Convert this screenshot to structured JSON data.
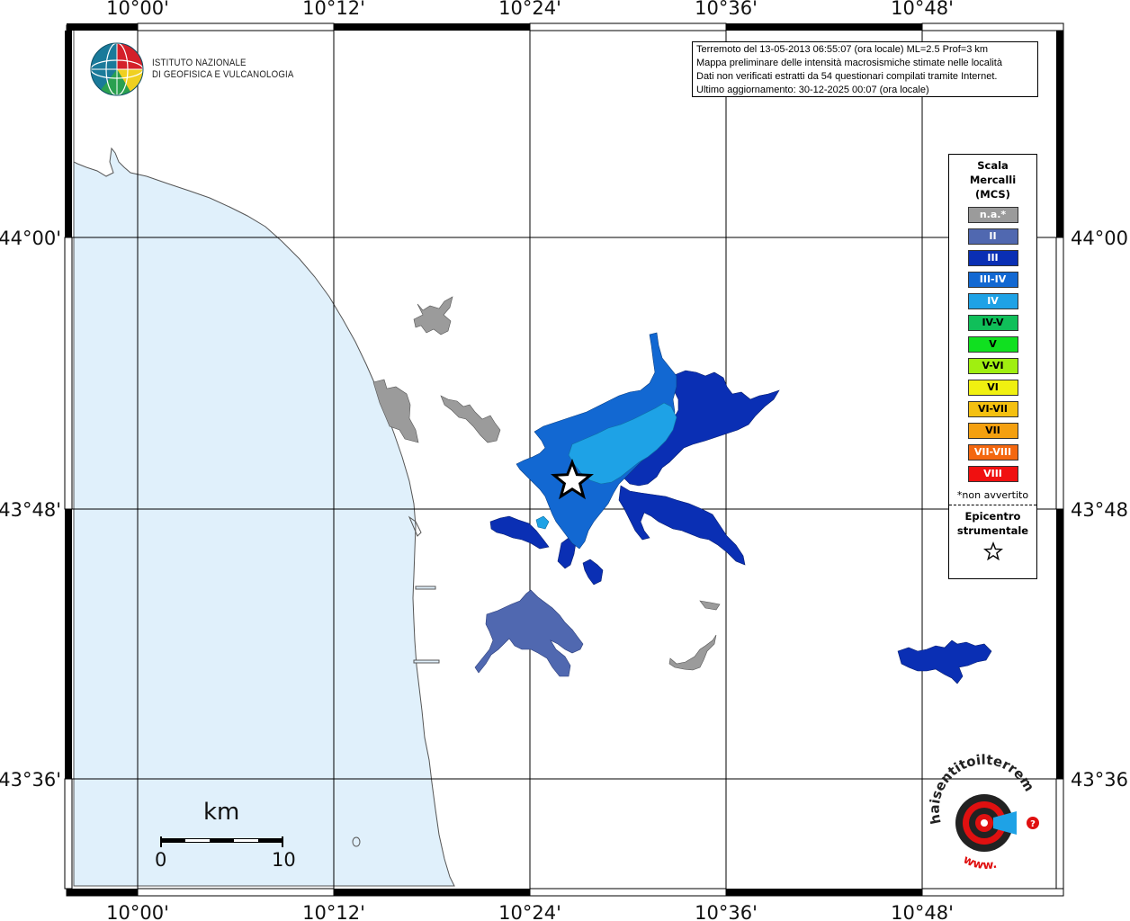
{
  "map": {
    "longitude_labels": [
      "10°00'",
      "10°12'",
      "10°24'",
      "10°36'",
      "10°48'"
    ],
    "latitude_labels": [
      "44°00'",
      "43°48'",
      "43°36'"
    ],
    "colors": {
      "sea": "#e0f0fb",
      "land": "#ffffff",
      "coast": "#555555",
      "grid": "#000000"
    }
  },
  "institute": {
    "line1": "ISTITUTO NAZIONALE",
    "line2": "DI GEOFISICA E VULCANOLOGIA",
    "logo_icon": "globe-icon"
  },
  "info": {
    "line1": "Terremoto del 13-05-2013 06:55:07 (ora locale) ML=2.5 Prof=3 km",
    "line2": "Mappa preliminare delle intensità macrosismiche stimate nelle località",
    "line3": "Dati non verificati estratti da 54 questionari compilati tramite Internet.",
    "line4": "Ultimo aggiornamento: 30-12-2025 00:07 (ora locale)"
  },
  "legend": {
    "title_line1": "Scala",
    "title_line2": "Mercalli",
    "title_line3": "(MCS)",
    "items": [
      {
        "label": "n.a.*",
        "color": "#9b9b9b"
      },
      {
        "label": "II",
        "color": "#5068b0"
      },
      {
        "label": "III",
        "color": "#0a2fb4"
      },
      {
        "label": "III-IV",
        "color": "#1268d2"
      },
      {
        "label": "IV",
        "color": "#1ea2e6"
      },
      {
        "label": "IV-V",
        "color": "#10bf5a"
      },
      {
        "label": "V",
        "color": "#10e020"
      },
      {
        "label": "V-VI",
        "color": "#a0ef10"
      },
      {
        "label": "VI",
        "color": "#f0f010"
      },
      {
        "label": "VI-VII",
        "color": "#f4c010"
      },
      {
        "label": "VII",
        "color": "#f4a010"
      },
      {
        "label": "VII-VIII",
        "color": "#f46810"
      },
      {
        "label": "VIII",
        "color": "#f01010"
      }
    ],
    "note": "*non avvertito",
    "epicenter_line1": "Epicentro",
    "epicenter_line2": "strumentale",
    "epicenter_icon": "star-icon"
  },
  "scale_bar": {
    "unit": "km",
    "start": "0",
    "end": "10"
  },
  "watermark": {
    "text_main": "haisentitoilterremoto.it",
    "text_www": "www.",
    "icon": "seismograph-logo-icon"
  }
}
